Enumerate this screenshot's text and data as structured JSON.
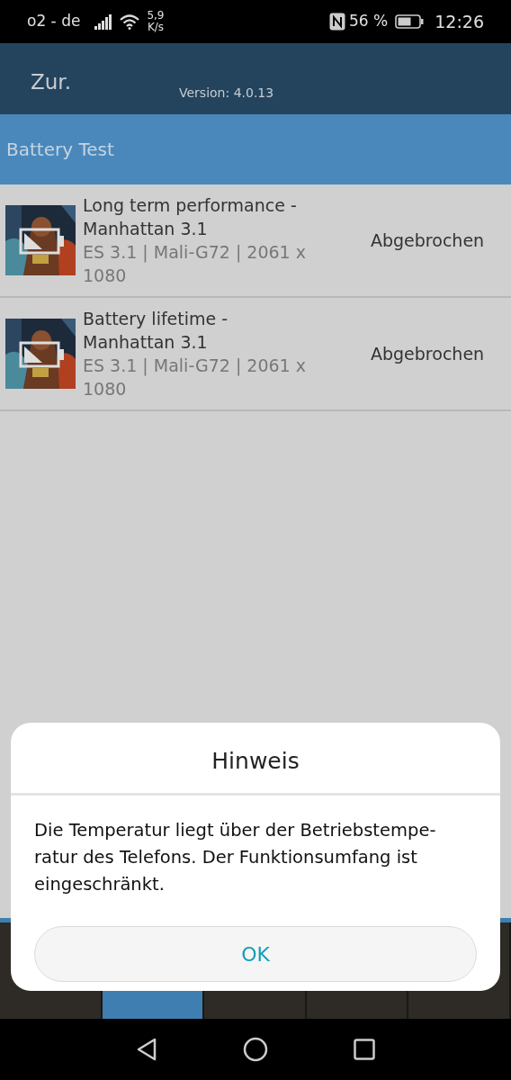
{
  "status_bar": {
    "carrier": "o2 - de",
    "speed_value": "5,9",
    "speed_unit": "K/s",
    "battery_percent": "56 %",
    "time": "12:26"
  },
  "header": {
    "back_label": "Zur.",
    "version": "Version: 4.0.13"
  },
  "section": {
    "title": "Battery Test"
  },
  "tests": [
    {
      "title": "Long term performance - Manhattan 3.1",
      "details": "ES 3.1 | Mali-G72 | 2061 x 1080",
      "status": "Abgebrochen"
    },
    {
      "title": "Battery lifetime - Manhattan 3.1",
      "details": "ES 3.1 | Mali-G72 | 2061 x 1080",
      "status": "Abgebrochen"
    }
  ],
  "bottom_tabs": [
    {
      "selected": false
    },
    {
      "selected": true
    },
    {
      "selected": false
    },
    {
      "selected": false
    },
    {
      "selected": false
    }
  ],
  "dialog": {
    "title": "Hinweis",
    "message": "Die Temperatur liegt über der Betriebstempe-ratur des Telefons. Der Funktionsumfang ist eingeschränkt.",
    "button": "OK"
  }
}
